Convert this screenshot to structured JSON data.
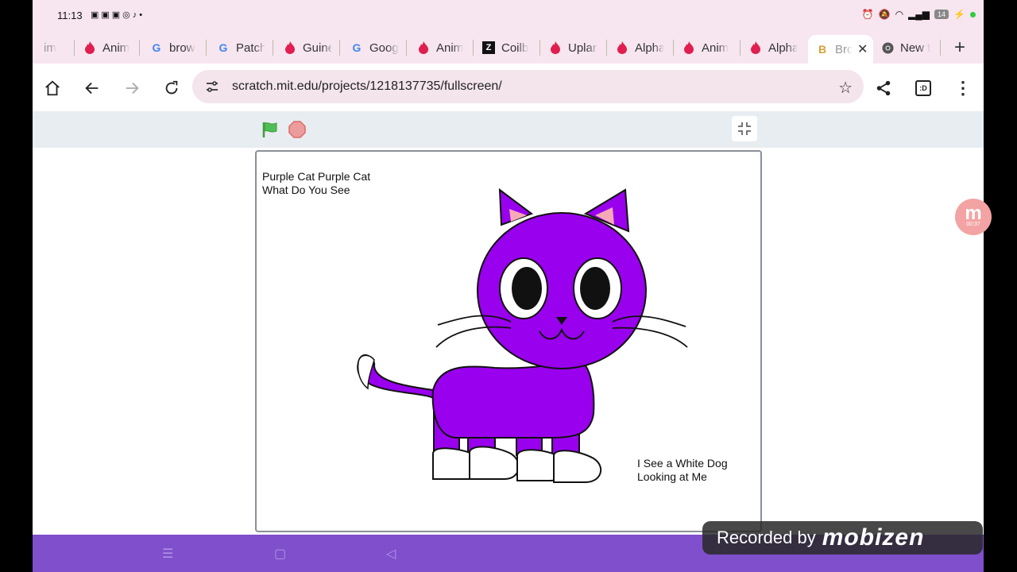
{
  "status_bar": {
    "time": "11:13",
    "battery": "14"
  },
  "tabs": [
    {
      "label": "Anim",
      "icon": "flame-icon"
    },
    {
      "label": "Anim",
      "icon": "flame-icon"
    },
    {
      "label": "brow",
      "icon": "google-icon"
    },
    {
      "label": "Patch",
      "icon": "google-icon"
    },
    {
      "label": "Guine",
      "icon": "flame-icon"
    },
    {
      "label": "Goog",
      "icon": "google-icon"
    },
    {
      "label": "Anim",
      "icon": "flame-icon"
    },
    {
      "label": "Coilb",
      "icon": "z-icon"
    },
    {
      "label": "Uplan",
      "icon": "flame-icon"
    },
    {
      "label": "Alpha",
      "icon": "flame-icon"
    },
    {
      "label": "Anim",
      "icon": "flame-icon"
    },
    {
      "label": "Alpha",
      "icon": "flame-icon"
    },
    {
      "label": "Bro",
      "icon": "coin-icon"
    },
    {
      "label": "New t",
      "icon": "chrome-icon"
    }
  ],
  "toolbar": {
    "url": "scratch.mit.edu/projects/1218137735/fullscreen/",
    "tab_count": ":D"
  },
  "stage": {
    "title_line1": "Purple Cat Purple Cat",
    "title_line2": "What Do You See",
    "caption_line1": "I See a White Dog",
    "caption_line2": "Looking at Me"
  },
  "overlay": {
    "recorded_by": "Recorded by",
    "brand": "mobizen",
    "bubble_letter": "m",
    "bubble_time": "00:37"
  },
  "colors": {
    "cat": "#9900ee",
    "stage_border": "#8a9099",
    "navbar": "#7f4fcc",
    "green_flag": "#4cbf56",
    "stop": "#ec9c9c"
  }
}
